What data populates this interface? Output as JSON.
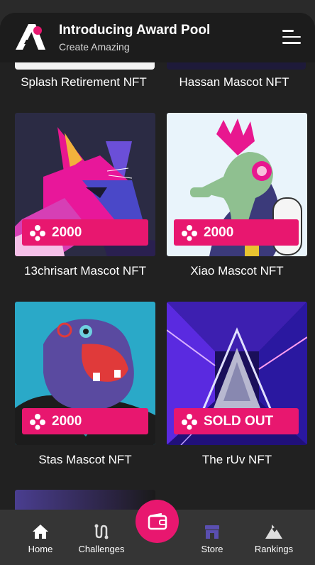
{
  "header": {
    "title": "Introducing Award Pool",
    "subtitle": "Create Amazing"
  },
  "top_row": [
    {
      "name": "Splash Retirement NFT"
    },
    {
      "name": "Hassan Mascot NFT"
    }
  ],
  "cards": [
    {
      "name": "13chrisart Mascot NFT",
      "price": "2000",
      "art": "fox"
    },
    {
      "name": "Xiao Mascot NFT",
      "price": "2000",
      "art": "seahorse"
    },
    {
      "name": "Stas Mascot NFT",
      "price": "2000",
      "art": "hippo"
    },
    {
      "name": "The rUv NFT",
      "price": "SOLD OUT",
      "art": "tunnel"
    }
  ],
  "nav": {
    "home": "Home",
    "challenges": "Challenges",
    "store": "Store",
    "rankings": "Rankings"
  },
  "colors": {
    "accent": "#e8176f",
    "background": "#212121",
    "navbar": "#353535",
    "active_nav": "#5a4fb0"
  }
}
